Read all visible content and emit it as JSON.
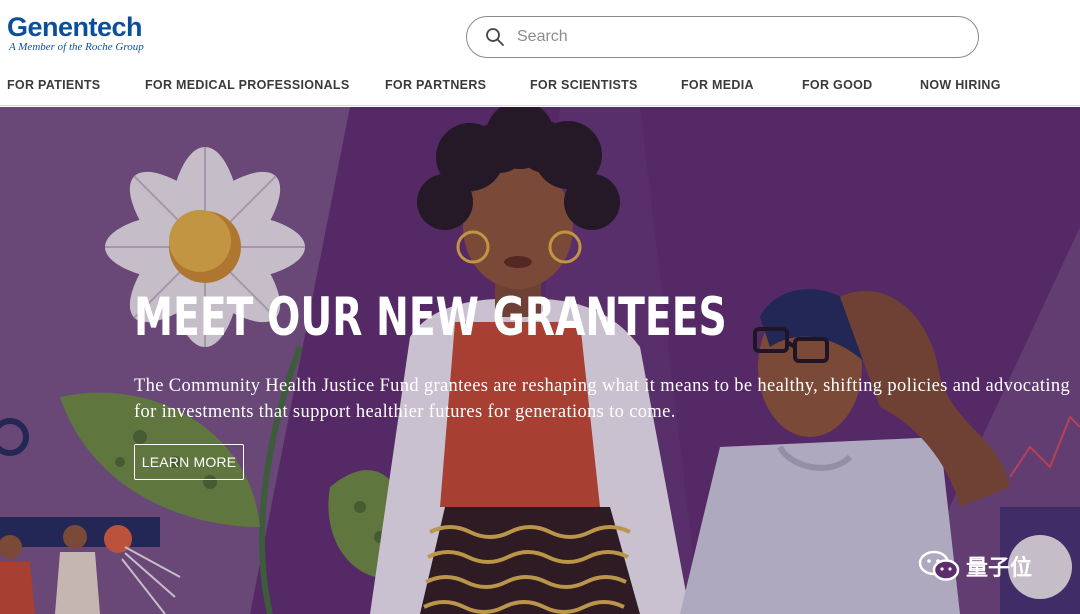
{
  "brand": {
    "name": "Genentech",
    "tagline": "A Member of the Roche Group",
    "color": "#0b4f9c"
  },
  "search": {
    "placeholder": "Search",
    "value": ""
  },
  "nav": {
    "items": [
      {
        "label": "FOR PATIENTS"
      },
      {
        "label": "FOR MEDICAL PROFESSIONALS"
      },
      {
        "label": "FOR PARTNERS"
      },
      {
        "label": "FOR SCIENTISTS"
      },
      {
        "label": "FOR MEDIA"
      },
      {
        "label": "FOR GOOD"
      },
      {
        "label": "NOW HIRING"
      }
    ]
  },
  "hero": {
    "title": "MEET OUR NEW GRANTEES",
    "body": "The Community Health Justice Fund grantees are reshaping what it means to be healthy, shifting policies and advocating for investments that support healthier futures for generations to come.",
    "cta_label": "LEARN MORE",
    "background_color": "#5b2d6c"
  },
  "watermark": {
    "text": "量子位",
    "icon": "wechat-icon"
  }
}
